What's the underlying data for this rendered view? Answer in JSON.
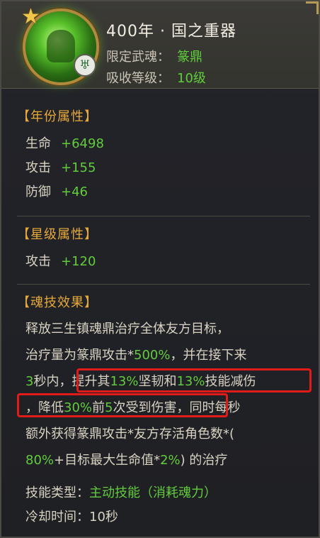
{
  "header": {
    "title": "400年 · 国之重器",
    "limit_label": "限定武魂：",
    "limit_value": "篆鼎",
    "level_label": "吸收等级：",
    "level_value": "10级"
  },
  "year_attrs": {
    "title": "【年份属性】",
    "items": [
      {
        "label": "生命",
        "value": "+6498"
      },
      {
        "label": "攻击",
        "value": "+155"
      },
      {
        "label": "防御",
        "value": "+46"
      }
    ]
  },
  "star_attrs": {
    "title": "【星级属性】",
    "items": [
      {
        "label": "攻击",
        "value": "+120"
      }
    ]
  },
  "skill": {
    "title": "【魂技效果】",
    "line1": "释放三生镇魂鼎治疗全体友方目标，",
    "line2_a": "治疗量为篆鼎攻击*",
    "line2_b": "500%",
    "line2_c": "，并在接下来",
    "line3_a": "3",
    "line3_b": "秒内，",
    "line3_c": "提升其",
    "line3_d": "13%",
    "line3_e": "坚韧和",
    "line3_f": "13%",
    "line3_g": "技能减伤",
    "line4_a": "，降低",
    "line4_b": "30%",
    "line4_c": "前",
    "line4_d": "5",
    "line4_e": "次受到伤害，",
    "line4_f": "同时每秒",
    "line5": "额外获得篆鼎攻击*友方存活角色数*(",
    "line6_a": "80%",
    "line6_b": "+目标最大生命值*",
    "line6_c": "2%",
    "line6_d": ") 的治疗",
    "type_label": "技能类型：",
    "type_value": "主动技能（消耗魂力）",
    "cd_label": "冷却时间：",
    "cd_value": "10秒"
  },
  "colors": {
    "accent_gold": "#e7a93a",
    "value_green": "#62cc3e",
    "highlight_red": "#e11a1a"
  },
  "icons": {
    "star": "star-icon",
    "badge": "wuhun-badge-icon",
    "soul_ring": "soul-ring-icon"
  }
}
